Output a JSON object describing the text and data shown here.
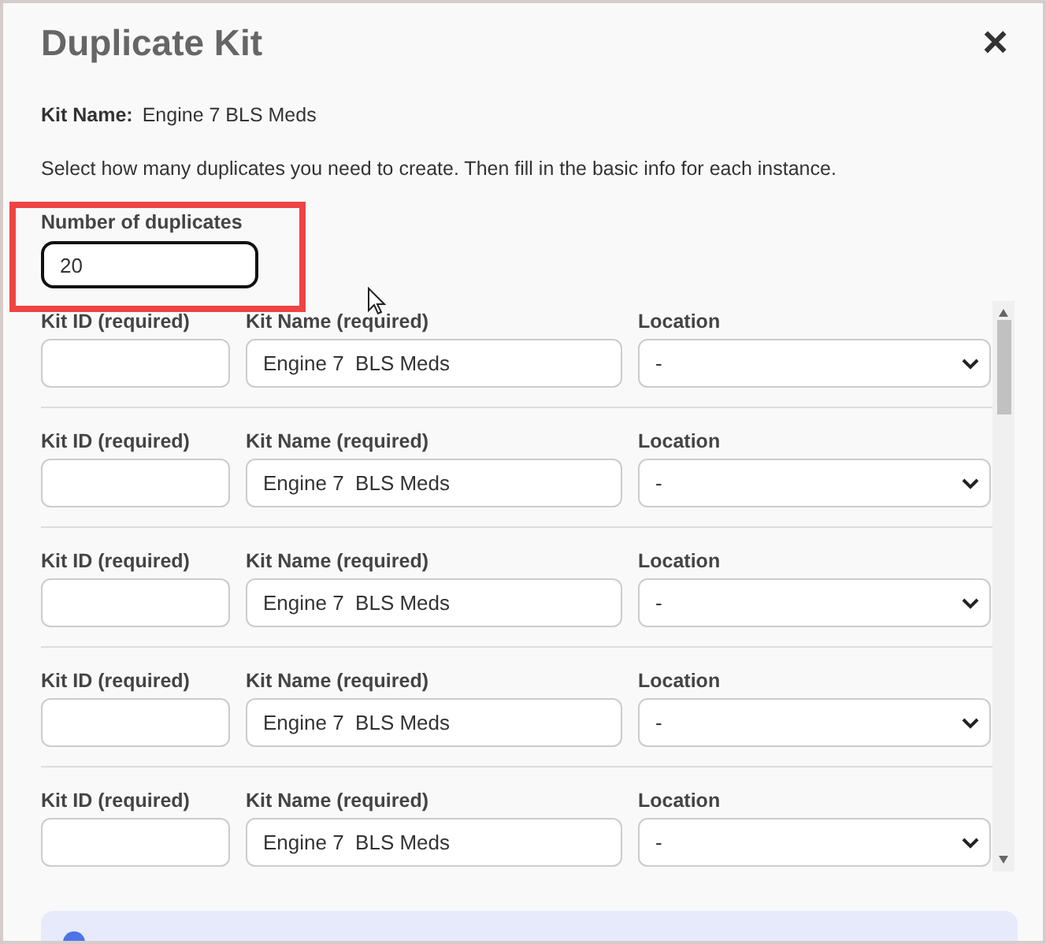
{
  "dialog": {
    "title": "Duplicate Kit",
    "close": "×"
  },
  "kit_name": {
    "label": "Kit Name:",
    "value": "Engine 7 BLS Meds"
  },
  "instructions": "Select how many duplicates you need to create. Then fill in the basic info for each instance.",
  "duplicates": {
    "label": "Number of duplicates",
    "value": "20",
    "highlighted": true
  },
  "rows": [
    {
      "id_label": "Kit ID (required)",
      "name_label": "Kit Name (required)",
      "name_value": "Engine 7  BLS Meds",
      "location_label": "Location",
      "location_value": "-"
    },
    {
      "id_label": "Kit ID (required)",
      "name_label": "Kit Name (required)",
      "name_value": "Engine 7  BLS Meds",
      "location_label": "Location",
      "location_value": "-"
    },
    {
      "id_label": "Kit ID (required)",
      "name_label": "Kit Name (required)",
      "name_value": "Engine 7  BLS Meds",
      "location_label": "Location",
      "location_value": "-"
    },
    {
      "id_label": "Kit ID (required)",
      "name_label": "Kit Name (required)",
      "name_value": "Engine 7  BLS Meds",
      "location_label": "Location",
      "location_value": "-"
    },
    {
      "id_label": "Kit ID (required)",
      "name_label": "Kit Name (required)",
      "name_value": "Engine 7  BLS Meds",
      "location_label": "Location",
      "location_value": "-"
    }
  ]
}
